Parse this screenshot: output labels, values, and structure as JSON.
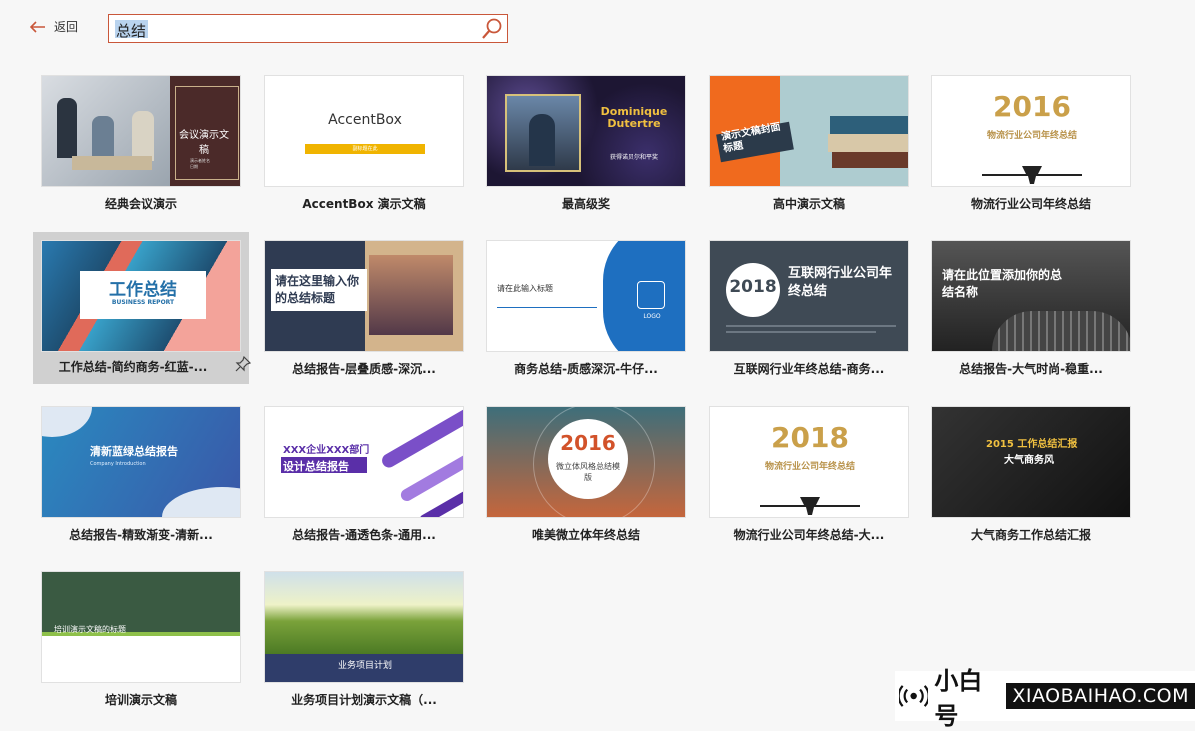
{
  "header": {
    "back_label": "返回",
    "search_value": "总结"
  },
  "templates": [
    {
      "label": "经典会议演示",
      "thumb": {
        "title": "会议演示文稿",
        "sub": "演示者姓名\n日期"
      }
    },
    {
      "label": "AccentBox 演示文稿",
      "thumb": {
        "title": "AccentBox",
        "sub": "副标题在此"
      }
    },
    {
      "label": "最高级奖",
      "thumb": {
        "title": "Dominique Dutertre",
        "sub": "获得诺贝尔和平奖"
      }
    },
    {
      "label": "高中演示文稿",
      "thumb": {
        "title": "演示文稿封面标题"
      }
    },
    {
      "label": "物流行业公司年终总结",
      "thumb": {
        "title": "2016",
        "sub": "物流行业公司年终总结"
      }
    },
    {
      "label": "工作总结-简约商务-红蓝-...",
      "thumb": {
        "title": "工作总结",
        "sub": "BUSINESS REPORT"
      }
    },
    {
      "label": "总结报告-层叠质感-深沉...",
      "thumb": {
        "title": "请在这里输入你的总结标题"
      }
    },
    {
      "label": "商务总结-质感深沉-牛仔...",
      "thumb": {
        "title": "请在此输入标题",
        "sub": "LOGO"
      }
    },
    {
      "label": "互联网行业年终总结-商务...",
      "thumb": {
        "title": "2018",
        "sub": "互联网行业公司年终总结"
      }
    },
    {
      "label": "总结报告-大气时尚-稳重...",
      "thumb": {
        "title": "请在此位置添加你的总结名称"
      }
    },
    {
      "label": "总结报告-精致渐变-清新...",
      "thumb": {
        "title": "清新蓝绿总结报告",
        "sub": "Company Introduction"
      }
    },
    {
      "label": "总结报告-通透色条-通用...",
      "thumb": {
        "title": "XXX企业XXX部门",
        "sub": "设计总结报告"
      }
    },
    {
      "label": "唯美微立体年终总结",
      "thumb": {
        "title": "2016",
        "sub": "微立体风格总结模版"
      }
    },
    {
      "label": "物流行业公司年终总结-大...",
      "thumb": {
        "title": "2018",
        "sub": "物流行业公司年终总结"
      }
    },
    {
      "label": "大气商务工作总结汇报",
      "thumb": {
        "title": "2015 工作总结汇报",
        "sub": "大气商务风"
      }
    },
    {
      "label": "培训演示文稿",
      "thumb": {
        "title": "培训演示文稿的标题"
      }
    },
    {
      "label": "业务项目计划演示文稿（...",
      "thumb": {
        "title": "业务项目计划"
      }
    }
  ],
  "watermark": {
    "zh": "小白号",
    "en": "XIAOBAIHAO.COM"
  },
  "colors": {
    "accent": "#c9573a",
    "selection": "#d0d0d0"
  }
}
